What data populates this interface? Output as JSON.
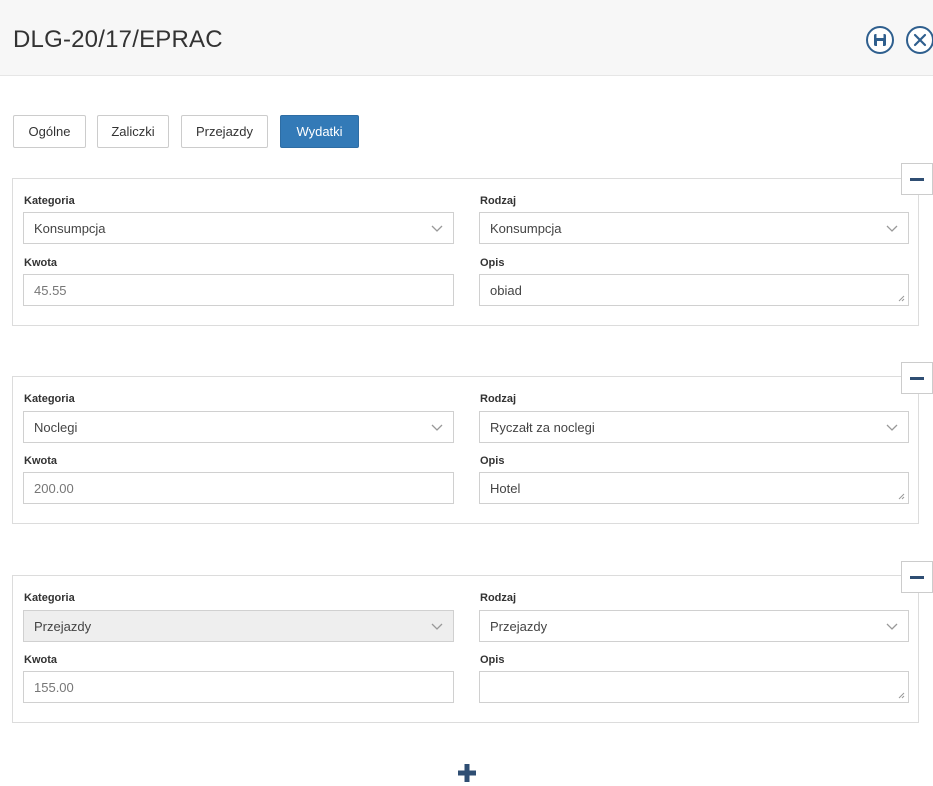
{
  "window": {
    "title": "DLG-20/17/EPRAC"
  },
  "icons": {
    "save": "save-icon",
    "close": "close-icon",
    "collapse": "minus-icon",
    "add": "plus-icon",
    "dropdown": "chevron-down-icon"
  },
  "colors": {
    "accent": "#337ab7",
    "icon": "#2f5f8e"
  },
  "tabs": [
    {
      "label": "Ogólne"
    },
    {
      "label": "Zaliczki"
    },
    {
      "label": "Przejazdy"
    },
    {
      "label": "Wydatki",
      "active": true
    }
  ],
  "expenses": [
    {
      "category_label": "Kategoria",
      "category": "Konsumpcja",
      "type_label": "Rodzaj",
      "type": "Konsumpcja",
      "amount_label": "Kwota",
      "amount": "45.55",
      "desc_label": "Opis",
      "desc": "obiad"
    },
    {
      "category_label": "Kategoria",
      "category": "Noclegi",
      "type_label": "Rodzaj",
      "type": "Ryczałt za noclegi",
      "amount_label": "Kwota",
      "amount": "200.00",
      "desc_label": "Opis",
      "desc": "Hotel"
    },
    {
      "category_label": "Kategoria",
      "category": "Przejazdy",
      "category_disabled": true,
      "type_label": "Rodzaj",
      "type": "Przejazdy",
      "amount_label": "Kwota",
      "amount": "155.00",
      "desc_label": "Opis",
      "desc": ""
    }
  ]
}
